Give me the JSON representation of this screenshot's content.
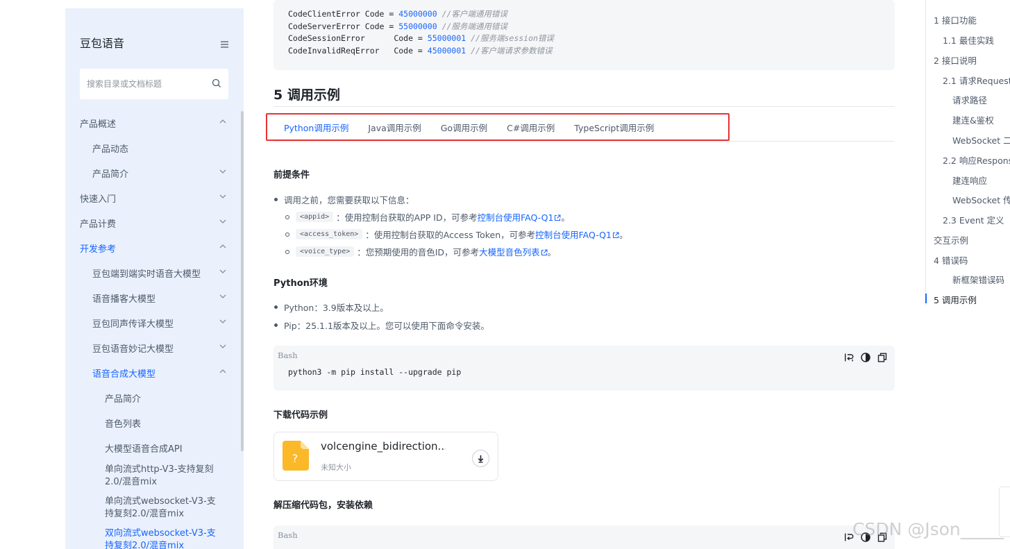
{
  "sidebar": {
    "title": "豆包语音",
    "search_placeholder": "搜索目录或文档标题",
    "items": [
      {
        "label": "产品概述",
        "level": 0,
        "chevron": "up",
        "active": false
      },
      {
        "label": "产品动态",
        "level": 1,
        "chevron": "none",
        "active": false
      },
      {
        "label": "产品简介",
        "level": 1,
        "chevron": "down",
        "active": false
      },
      {
        "label": "快速入门",
        "level": 0,
        "chevron": "down",
        "active": false
      },
      {
        "label": "产品计费",
        "level": 0,
        "chevron": "down",
        "active": false
      },
      {
        "label": "开发参考",
        "level": 0,
        "chevron": "up",
        "active": true
      },
      {
        "label": "豆包端到端实时语音大模型",
        "level": 1,
        "chevron": "down",
        "active": false
      },
      {
        "label": "语音播客大模型",
        "level": 1,
        "chevron": "down",
        "active": false
      },
      {
        "label": "豆包同声传译大模型",
        "level": 1,
        "chevron": "down",
        "active": false
      },
      {
        "label": "豆包语音妙记大模型",
        "level": 1,
        "chevron": "down",
        "active": false
      },
      {
        "label": "语音合成大模型",
        "level": 1,
        "chevron": "up",
        "active": true
      },
      {
        "label": "产品简介",
        "level": 2,
        "chevron": "none",
        "active": false
      },
      {
        "label": "音色列表",
        "level": 2,
        "chevron": "none",
        "active": false
      },
      {
        "label": "大模型语音合成API",
        "level": 2,
        "chevron": "none",
        "active": false
      },
      {
        "label": "单向流式http-V3-支持复刻2.0/混音mix",
        "level": 2,
        "chevron": "none",
        "active": false,
        "tall": true
      },
      {
        "label": "单向流式websocket-V3-支持复刻2.0/混音mix",
        "level": 2,
        "chevron": "none",
        "active": false,
        "tall": true
      },
      {
        "label": "双向流式websocket-V3-支持复刻2.0/混音mix",
        "level": 2,
        "chevron": "none",
        "active": true,
        "tall": true
      }
    ]
  },
  "code_top": [
    {
      "name": "CodeClientError Code = ",
      "num": "45000000",
      "comment": "//客户端通用错误"
    },
    {
      "name": "CodeServerError Code = ",
      "num": "55000000",
      "comment": "//服务端通用错误"
    },
    {
      "name": "CodeSessionError      Code = ",
      "num": "55000001",
      "comment": "//服务端session错误"
    },
    {
      "name": "CodeInvalidReqError   Code = ",
      "num": "45000001",
      "comment": "//客户端请求参数错误"
    }
  ],
  "section_title": "5 调用示例",
  "tabs": [
    "Python调用示例",
    "Java调用示例",
    "Go调用示例",
    "C#调用示例",
    "TypeScript调用示例"
  ],
  "prereq": {
    "title": "前提条件",
    "intro": "调用之前，您需要获取以下信息：",
    "items": [
      {
        "tag": "<appid>",
        "text": "：使用控制台获取的APP ID，可参考 ",
        "link": "控制台使用FAQ-Q1",
        "suffix": "。"
      },
      {
        "tag": "<access_token>",
        "text": "：使用控制台获取的Access Token，可参考 ",
        "link": "控制台使用FAQ-Q1",
        "suffix": "。"
      },
      {
        "tag": "<voice_type>",
        "text": "：您预期使用的音色ID，可参考 ",
        "link": "大模型音色列表",
        "suffix": "。"
      }
    ]
  },
  "python_env": {
    "title": "Python环境",
    "items": [
      "Python：3.9版本及以上。",
      "Pip：25.1.1版本及以上。您可以使用下面命令安装。"
    ]
  },
  "bash1": {
    "lang": "Bash",
    "code": "python3 -m pip install --upgrade pip"
  },
  "download": {
    "title": "下载代码示例",
    "file_name": "volcengine_bidirection...",
    "file_size": "未知大小"
  },
  "unzip": {
    "title": "解压缩代码包，安装依赖"
  },
  "bash2": {
    "lang": "Bash"
  },
  "toc": [
    {
      "label": "1 接口功能",
      "indent": 0
    },
    {
      "label": "1.1 最佳实践",
      "indent": 1
    },
    {
      "label": "2 接口说明",
      "indent": 0
    },
    {
      "label": "2.1 请求Request",
      "indent": 1
    },
    {
      "label": "请求路径",
      "indent": 2
    },
    {
      "label": "建连&鉴权",
      "indent": 2
    },
    {
      "label": "WebSocket 二",
      "indent": 2
    },
    {
      "label": "2.2 响应Respons",
      "indent": 1
    },
    {
      "label": "建连响应",
      "indent": 2
    },
    {
      "label": "WebSocket 传",
      "indent": 2
    },
    {
      "label": "2.3 Event 定义",
      "indent": 1
    },
    {
      "label": "交互示例",
      "indent": 0
    },
    {
      "label": "4 错误码",
      "indent": 0
    },
    {
      "label": "新框架错误码",
      "indent": 2
    },
    {
      "label": "5 调用示例",
      "indent": 0
    }
  ],
  "watermark": "CSDN @Json_____",
  "colors": {
    "accent": "#1664ff",
    "highlight_border": "#e63333",
    "sidebar_bg": "#eaf1fc"
  }
}
